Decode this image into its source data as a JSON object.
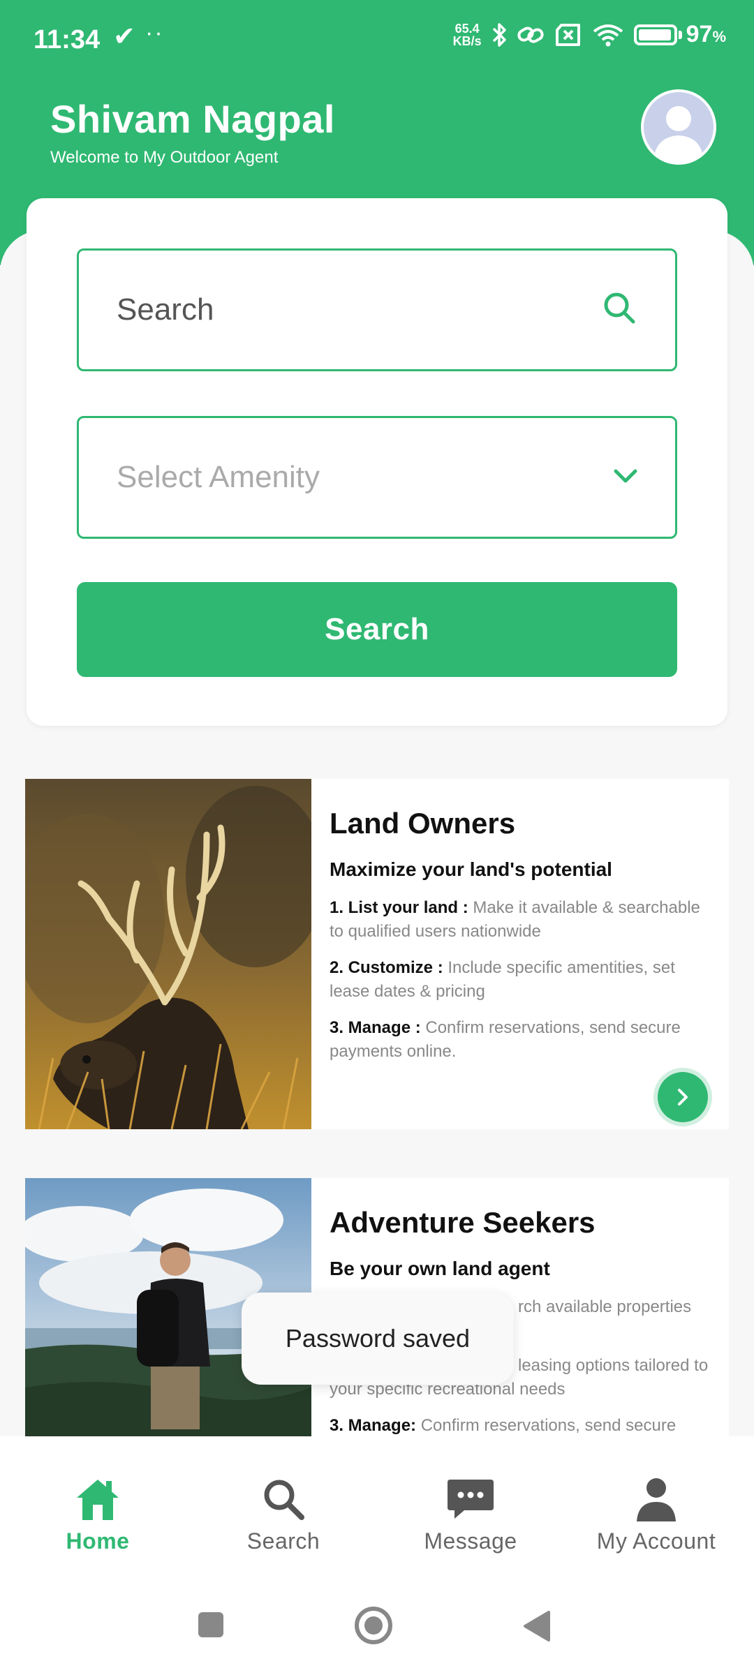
{
  "status_bar": {
    "time": "11:34",
    "check_glyph": "✔",
    "dots": "··",
    "net_speed_value": "65.4",
    "net_speed_unit": "KB/s",
    "battery_percent": "97",
    "battery_percent_sign": "%",
    "battery_level": 0.97,
    "icons": [
      "bluetooth-icon",
      "link-icon",
      "sim-x-icon",
      "wifi-icon",
      "battery-icon"
    ]
  },
  "header": {
    "user_name": "Shivam Nagpal",
    "welcome_text": "Welcome to My Outdoor Agent"
  },
  "search_card": {
    "search_placeholder": "Search",
    "amenity_placeholder": "Select Amenity",
    "search_button_label": "Search"
  },
  "features": [
    {
      "title": "Land Owners",
      "subtitle": "Maximize your land's potential",
      "steps": [
        {
          "label": "1. List your land :",
          "text": "Make it available & searchable to qualified users nationwide"
        },
        {
          "label": "2. Customize :",
          "text": "Include specific amentities, set lease dates & pricing"
        },
        {
          "label": "3. Manage :",
          "text": "Confirm reservations, send secure payments online."
        }
      ]
    },
    {
      "title": "Adventure Seekers",
      "subtitle": "Be your own land agent",
      "steps": [
        {
          "label": "",
          "text": "rch available properties"
        },
        {
          "label": "",
          "text": "leasing options tailored to your specific recreational needs"
        },
        {
          "label": "3. Manage:",
          "text": "Confirm reservations, send secure"
        }
      ]
    }
  ],
  "toast": {
    "message": "Password saved"
  },
  "bottom_nav": {
    "items": [
      {
        "label": "Home",
        "active": true
      },
      {
        "label": "Search",
        "active": false
      },
      {
        "label": "Message",
        "active": false
      },
      {
        "label": "My Account",
        "active": false
      }
    ]
  },
  "colors": {
    "brand_green": "#2fb872",
    "background": "#f7f7f7",
    "inactive_nav": "#666666"
  }
}
